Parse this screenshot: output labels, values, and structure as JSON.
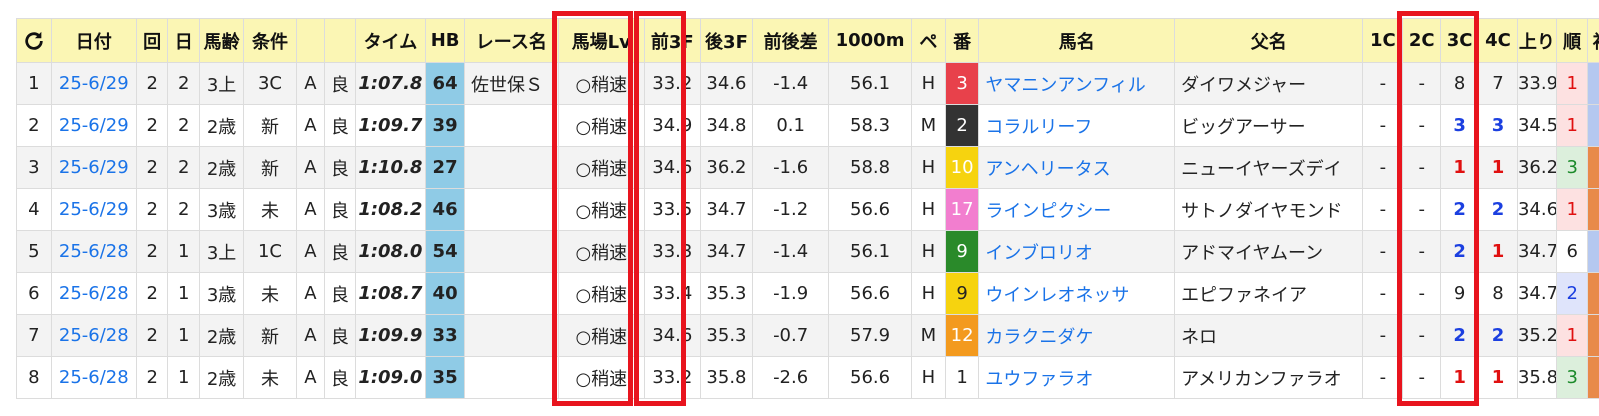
{
  "headers": {
    "date": "日付",
    "kai": "回",
    "nichi": "日",
    "age": "馬齢",
    "cond": "条件",
    "time": "タイム",
    "hb": "HB",
    "race": "レース名",
    "babalv": "馬場Lv",
    "f3f": "前3F",
    "l3f": "後3F",
    "diff": "前後差",
    "m1000": "1000m",
    "pe": "ペ",
    "ban": "番",
    "horse": "馬名",
    "sire": "父名",
    "c1": "1C",
    "c2": "2C",
    "c3": "3C",
    "c4": "4C",
    "agari": "上り",
    "rank": "順",
    "last": "衫"
  },
  "rows": [
    {
      "no": "1",
      "date": "25-6/29",
      "kai": "2",
      "nichi": "2",
      "age": "3上",
      "cond": "3C",
      "grade": "A",
      "track": "良",
      "time": "1:07.8",
      "hb": "64",
      "race": "佐世保Ｓ",
      "baba": "○稍速",
      "f3f": "33.2",
      "l3f": "34.6",
      "diff": "-1.4",
      "m1000": "56.1",
      "pe": "H",
      "ban": "3",
      "horse": "ヤマニンアンフィル",
      "sire": "ダイワメジャー",
      "c1": "-",
      "c2": "-",
      "c3": "8",
      "c4": "7",
      "agari": "33.9",
      "rank": "1"
    },
    {
      "no": "2",
      "date": "25-6/29",
      "kai": "2",
      "nichi": "2",
      "age": "2歳",
      "cond": "新",
      "grade": "A",
      "track": "良",
      "time": "1:09.7",
      "hb": "39",
      "race": "",
      "baba": "○稍速",
      "f3f": "34.9",
      "l3f": "34.8",
      "diff": "0.1",
      "m1000": "58.3",
      "pe": "M",
      "ban": "2",
      "horse": "コラルリーフ",
      "sire": "ビッグアーサー",
      "c1": "-",
      "c2": "-",
      "c3": "3",
      "c4": "3",
      "agari": "34.5",
      "rank": "1"
    },
    {
      "no": "3",
      "date": "25-6/29",
      "kai": "2",
      "nichi": "2",
      "age": "2歳",
      "cond": "新",
      "grade": "A",
      "track": "良",
      "time": "1:10.8",
      "hb": "27",
      "race": "",
      "baba": "○稍速",
      "f3f": "34.6",
      "l3f": "36.2",
      "diff": "-1.6",
      "m1000": "58.8",
      "pe": "H",
      "ban": "10",
      "horse": "アンヘリータス",
      "sire": "ニューイヤーズデイ",
      "c1": "-",
      "c2": "-",
      "c3": "1",
      "c4": "1",
      "agari": "36.2",
      "rank": "3"
    },
    {
      "no": "4",
      "date": "25-6/29",
      "kai": "2",
      "nichi": "2",
      "age": "3歳",
      "cond": "未",
      "grade": "A",
      "track": "良",
      "time": "1:08.2",
      "hb": "46",
      "race": "",
      "baba": "○稍速",
      "f3f": "33.5",
      "l3f": "34.7",
      "diff": "-1.2",
      "m1000": "56.6",
      "pe": "H",
      "ban": "17",
      "horse": "ラインピクシー",
      "sire": "サトノダイヤモンド",
      "c1": "-",
      "c2": "-",
      "c3": "2",
      "c4": "2",
      "agari": "34.6",
      "rank": "1"
    },
    {
      "no": "5",
      "date": "25-6/28",
      "kai": "2",
      "nichi": "1",
      "age": "3上",
      "cond": "1C",
      "grade": "A",
      "track": "良",
      "time": "1:08.0",
      "hb": "54",
      "race": "",
      "baba": "○稍速",
      "f3f": "33.3",
      "l3f": "34.7",
      "diff": "-1.4",
      "m1000": "56.1",
      "pe": "H",
      "ban": "9",
      "horse": "インブロリオ",
      "sire": "アドマイヤムーン",
      "c1": "-",
      "c2": "-",
      "c3": "2",
      "c4": "1",
      "agari": "34.7",
      "rank": "6"
    },
    {
      "no": "6",
      "date": "25-6/28",
      "kai": "2",
      "nichi": "1",
      "age": "3歳",
      "cond": "未",
      "grade": "A",
      "track": "良",
      "time": "1:08.7",
      "hb": "40",
      "race": "",
      "baba": "○稍速",
      "f3f": "33.4",
      "l3f": "35.3",
      "diff": "-1.9",
      "m1000": "56.6",
      "pe": "H",
      "ban": "9",
      "horse": "ウインレオネッサ",
      "sire": "エピファネイア",
      "c1": "-",
      "c2": "-",
      "c3": "9",
      "c4": "8",
      "agari": "34.7",
      "rank": "2"
    },
    {
      "no": "7",
      "date": "25-6/28",
      "kai": "2",
      "nichi": "1",
      "age": "2歳",
      "cond": "新",
      "grade": "A",
      "track": "良",
      "time": "1:09.9",
      "hb": "33",
      "race": "",
      "baba": "○稍速",
      "f3f": "34.6",
      "l3f": "35.3",
      "diff": "-0.7",
      "m1000": "57.9",
      "pe": "M",
      "ban": "12",
      "horse": "カラクニダケ",
      "sire": "ネロ",
      "c1": "-",
      "c2": "-",
      "c3": "2",
      "c4": "2",
      "agari": "35.2",
      "rank": "1"
    },
    {
      "no": "8",
      "date": "25-6/28",
      "kai": "2",
      "nichi": "1",
      "age": "2歳",
      "cond": "未",
      "grade": "A",
      "track": "良",
      "time": "1:09.0",
      "hb": "35",
      "race": "",
      "baba": "○稍速",
      "f3f": "33.2",
      "l3f": "35.8",
      "diff": "-2.6",
      "m1000": "56.6",
      "pe": "H",
      "ban": "1",
      "horse": "ユウファラオ",
      "sire": "アメリカンファラオ",
      "c1": "-",
      "c2": "-",
      "c3": "1",
      "c4": "1",
      "agari": "35.8",
      "rank": "3"
    }
  ],
  "colors": {
    "header_bg": "#fbf6b4",
    "hb_bg": "#8fcbe6",
    "highlight_border": "#e8141e",
    "link": "#1a73e8",
    "gate_by_number": {
      "1": "#ffffff",
      "2": "#333333",
      "3": "#e8414b",
      "9": "#f6d30f",
      "10": "#f6d30f",
      "12": "#f39a1e",
      "17": "#f27ecf"
    },
    "gate_9_green": "#2a8a2a",
    "rank_bg": {
      "1": "#fde1e1",
      "2": "#dfe4fb",
      "3": "#dcefdc",
      "6": "#ffffff"
    },
    "side_strips": [
      "#b5c8f0",
      "#b5c8f0",
      "#e88a4a",
      "#e88a4a",
      "#b5c8f0",
      "#e88a4a",
      "#e88a4a",
      "#e88a4a"
    ]
  },
  "icons": {
    "refresh": "refresh-icon"
  }
}
